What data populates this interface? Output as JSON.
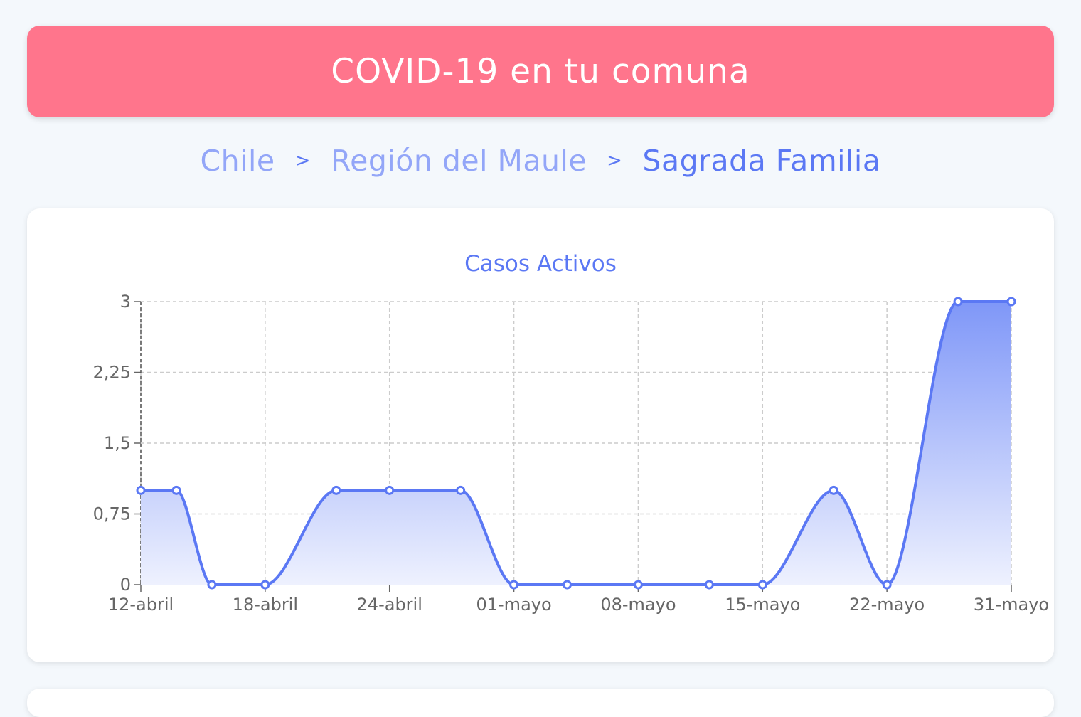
{
  "header": {
    "title": "COVID-19 en tu comuna"
  },
  "breadcrumb": {
    "items": [
      "Chile",
      "Región del Maule",
      "Sagrada Familia"
    ],
    "separator": ">"
  },
  "colors": {
    "header_bg": "#ff758c",
    "accent": "#5b78f4",
    "breadcrumb_inactive": "#93a6f8",
    "area_top": "#7f97f8",
    "area_bottom": "#eef1fe"
  },
  "chart_data": {
    "type": "area",
    "title": "Casos Activos",
    "x": [
      "2020-04-12",
      "2020-04-14",
      "2020-04-16",
      "2020-04-19",
      "2020-04-23",
      "2020-04-26",
      "2020-04-30",
      "2020-05-03",
      "2020-05-06",
      "2020-05-10",
      "2020-05-14",
      "2020-05-17",
      "2020-05-21",
      "2020-05-24",
      "2020-05-28",
      "2020-05-31"
    ],
    "values": [
      1,
      1,
      0,
      0,
      1,
      1,
      1,
      0,
      0,
      0,
      0,
      0,
      1,
      0,
      3,
      3
    ],
    "xticks": [
      "12-abril",
      "18-abril",
      "24-abril",
      "01-mayo",
      "08-mayo",
      "15-mayo",
      "22-mayo",
      "31-mayo"
    ],
    "yticks": [
      "0",
      "0,75",
      "1,5",
      "2,25",
      "3"
    ],
    "ylim": [
      0,
      3
    ],
    "grid": true,
    "smooth": true,
    "markers": true
  }
}
